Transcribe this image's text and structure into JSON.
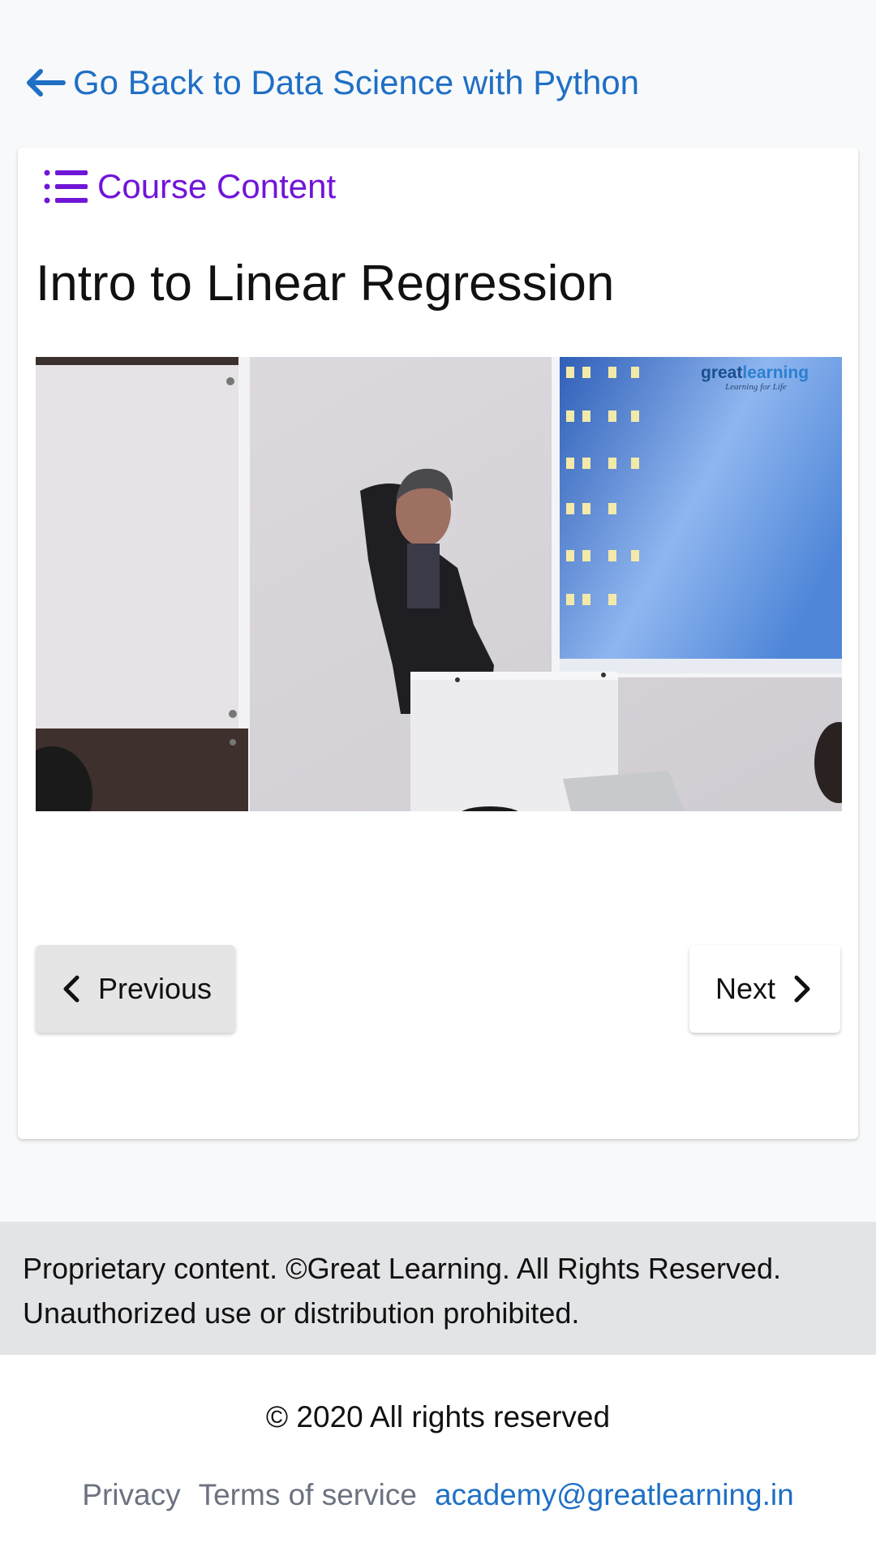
{
  "nav": {
    "back_label": "Go Back to Data Science with Python"
  },
  "course": {
    "content_label": "Course Content",
    "lesson_title": "Intro to Linear Regression"
  },
  "video": {
    "watermark_brand_part1": "great",
    "watermark_brand_part2": "learning",
    "watermark_tagline": "Learning for Life"
  },
  "pagination": {
    "previous_label": "Previous",
    "next_label": "Next"
  },
  "notice": {
    "line1": "Proprietary content. ©Great Learning. All Rights Reserved.",
    "line2": "Unauthorized use or distribution prohibited."
  },
  "footer": {
    "copyright": "© 2020 All rights reserved",
    "links": {
      "privacy": "Privacy",
      "terms": "Terms of service",
      "email": "academy@greatlearning.in"
    }
  },
  "colors": {
    "link_blue": "#1f6fc5",
    "accent_purple": "#7015d8",
    "page_bg": "#f8f9fa",
    "notice_bg": "#e3e4e6"
  },
  "icons": {
    "back": "arrow-left-icon",
    "course_content": "list-icon",
    "previous": "chevron-left-icon",
    "next": "chevron-right-icon"
  }
}
